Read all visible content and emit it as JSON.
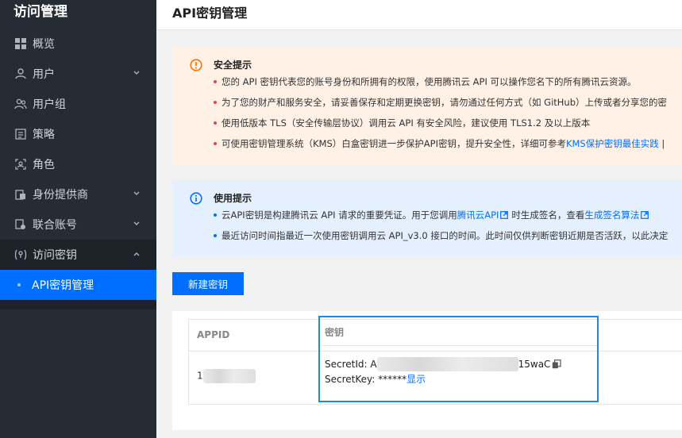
{
  "sidebar": {
    "title": "访问管理",
    "items": [
      {
        "label": "概览",
        "icon": "grid-icon",
        "expandable": false
      },
      {
        "label": "用户",
        "icon": "user-icon",
        "expandable": true
      },
      {
        "label": "用户组",
        "icon": "user-group-icon",
        "expandable": false
      },
      {
        "label": "策略",
        "icon": "policy-icon",
        "expandable": false
      },
      {
        "label": "角色",
        "icon": "role-icon",
        "expandable": false
      },
      {
        "label": "身份提供商",
        "icon": "identity-provider-icon",
        "expandable": true
      },
      {
        "label": "联合账号",
        "icon": "federated-account-icon",
        "expandable": true
      },
      {
        "label": "访问密钥",
        "icon": "key-icon",
        "expandable": true,
        "expanded": true
      }
    ],
    "active_sub_item": "API密钥管理"
  },
  "header": {
    "title": "API密钥管理"
  },
  "security_notice": {
    "title": "安全提示",
    "items": [
      "您的 API 密钥代表您的账号身份和所拥有的权限，使用腾讯云 API 可以操作您名下的所有腾讯云资源。",
      "为了您的财产和服务安全，请妥善保存和定期更换密钥，请勿通过任何方式（如 GitHub）上传或者分享您的密",
      "使用低版本 TLS（安全传输层协议）调用云 API 有安全风险，建议使用 TLS1.2 及以上版本"
    ],
    "last_item_prefix": "可使用密钥管理系统（KMS）白盒密钥进一步保护API密钥，提升安全性，详细可参考",
    "last_item_link": "KMS保护密钥最佳实践",
    "last_item_suffix": " |"
  },
  "usage_notice": {
    "title": "使用提示",
    "item1_prefix": "云API密钥是构建腾讯云 API 请求的重要凭证。用于您调用",
    "item1_link1": "腾讯云API",
    "item1_middle": "时生成签名，查看",
    "item1_link2": "生成签名算法",
    "item2": "最近访问时间指最近一次使用密钥调用云 API_v3.0 接口的时间。此时间仅供判断密钥近期是否活跃，以此决定"
  },
  "create_button": "新建密钥",
  "table": {
    "columns": {
      "appid": "APPID",
      "key": "密钥"
    },
    "rows": [
      {
        "appid_visible": "1",
        "secret_id_label": "SecretId:",
        "secret_id_prefix": "A",
        "secret_id_suffix": "15waC",
        "secret_key_label": "SecretKey:",
        "secret_key_value": "******",
        "show_link": "显示"
      }
    ]
  },
  "colors": {
    "sidebar_bg": "#262c34",
    "accent": "#006eff",
    "warn_bg": "#fff1e6",
    "info_bg": "#e5f0ff",
    "warn_icon": "#ff7200",
    "highlight_border": "#1e88e5"
  }
}
